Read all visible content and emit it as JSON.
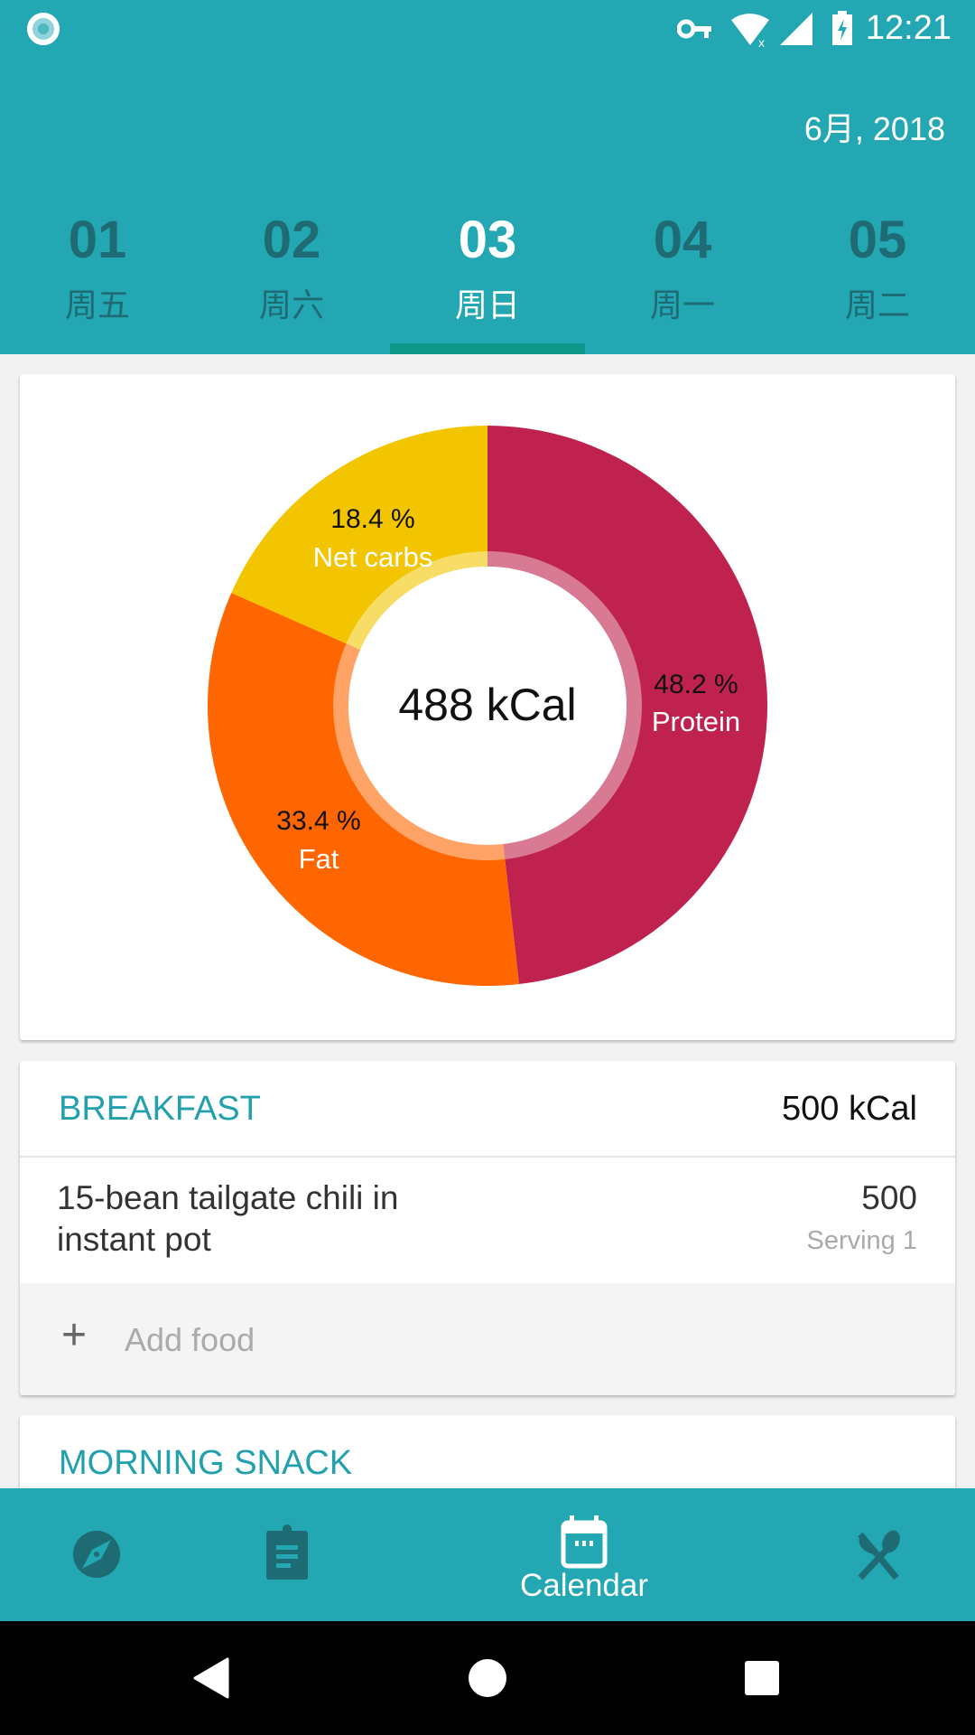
{
  "status_bar": {
    "time": "12:21",
    "icons": [
      "app-notification-icon",
      "vpn-key-icon",
      "wifi-icon",
      "signal-icon",
      "battery-charging-icon"
    ]
  },
  "header": {
    "month_year": "6月, 2018",
    "days": [
      {
        "num": "01",
        "weekday": "周五"
      },
      {
        "num": "02",
        "weekday": "周六"
      },
      {
        "num": "03",
        "weekday": "周日",
        "selected": true
      },
      {
        "num": "04",
        "weekday": "周一"
      },
      {
        "num": "05",
        "weekday": "周二"
      }
    ]
  },
  "chart_data": {
    "type": "pie",
    "center_label": "488 kCal",
    "slices": [
      {
        "name": "Protein",
        "value": 48.2,
        "label": "48.2 %",
        "color": "#c0224f"
      },
      {
        "name": "Fat",
        "value": 33.4,
        "label": "33.4 %",
        "color": "#ff6600"
      },
      {
        "name": "Net carbs",
        "value": 18.4,
        "label": "18.4 %",
        "color": "#f2c500"
      }
    ]
  },
  "breakfast": {
    "title": "BREAKFAST",
    "total": "500 kCal",
    "items": [
      {
        "name_line1": "15-bean tailgate chili in",
        "name_line2": "instant pot",
        "kcal": "500",
        "serving": "Serving 1"
      }
    ],
    "add_label": "Add food"
  },
  "morning_snack": {
    "title": "MORNING SNACK"
  },
  "bottom_nav": {
    "items": [
      {
        "icon": "compass-icon"
      },
      {
        "icon": "clipboard-icon"
      },
      {
        "icon": "calendar-icon",
        "label": "Calendar",
        "selected": true
      },
      {
        "icon": "fork-knife-icon"
      }
    ]
  },
  "colors": {
    "primary": "#22a7b3",
    "indicator": "#0f978a",
    "inactive": "#1f6b73"
  }
}
